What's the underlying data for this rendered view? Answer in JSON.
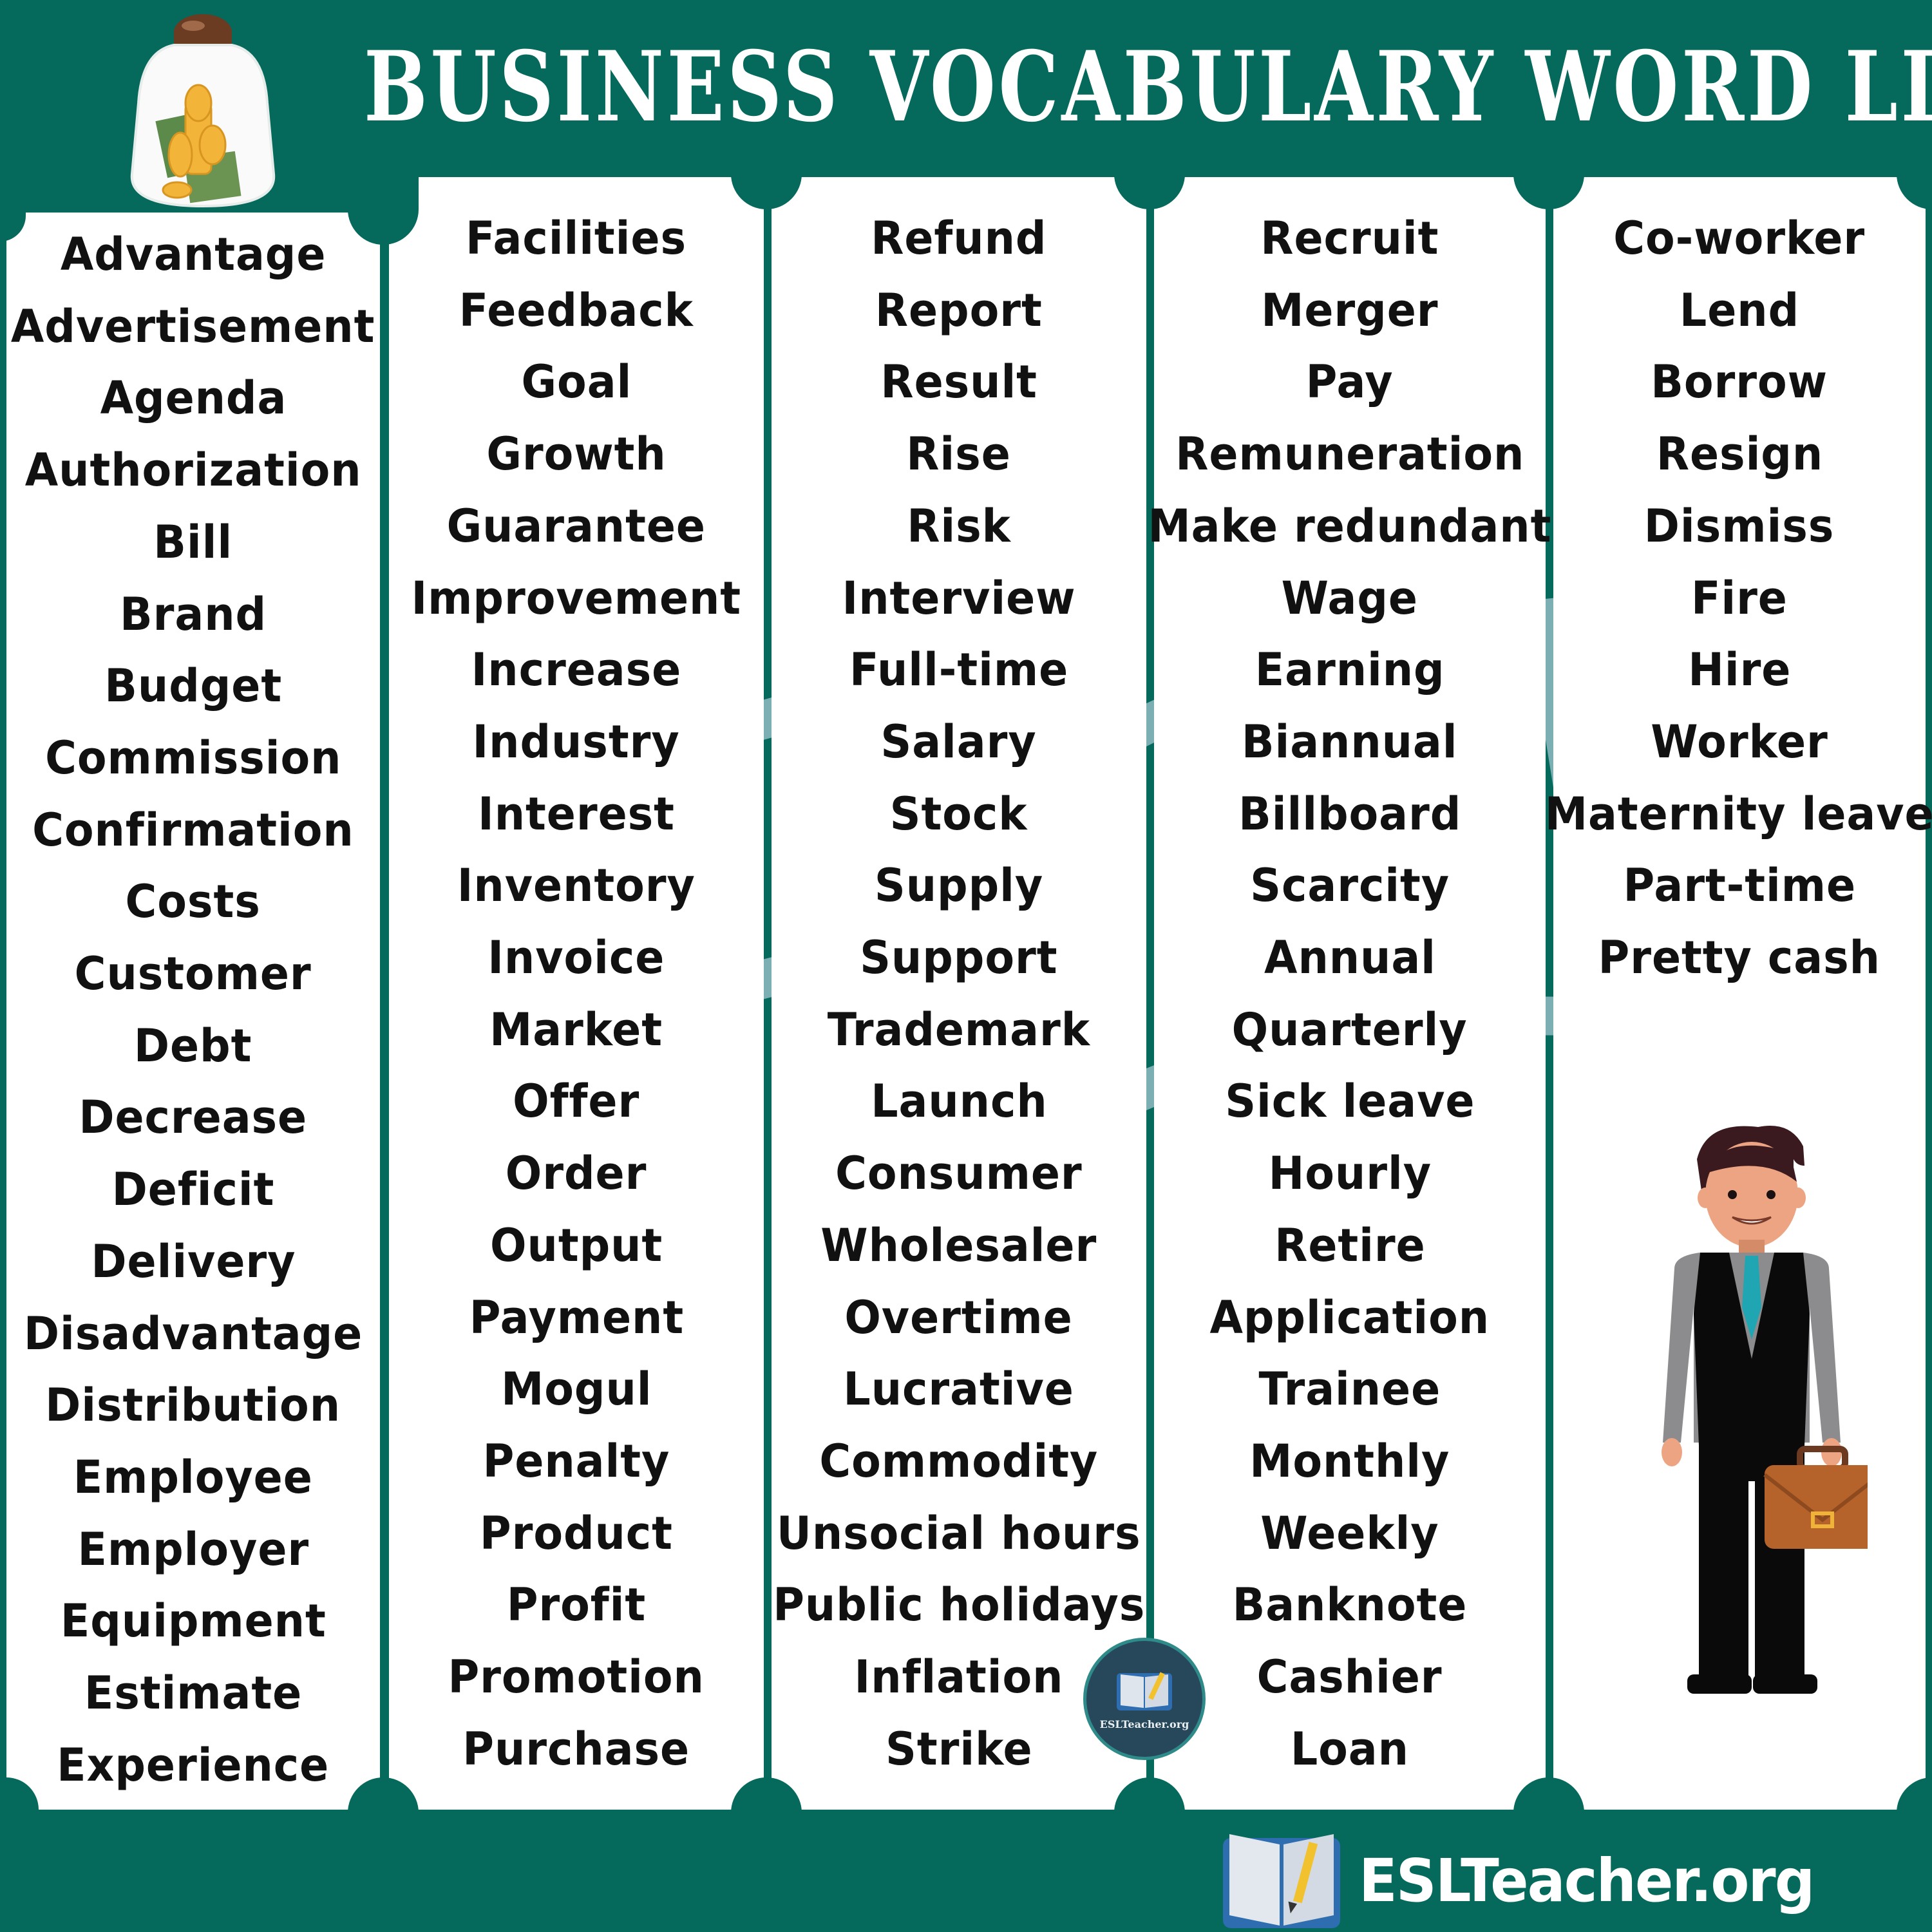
{
  "header": {
    "title": "BUSINESS VOCABULARY WORD LIST",
    "jar_icon": "coin-jar-icon"
  },
  "colors": {
    "brand_green": "#05695b",
    "panel_white": "#ffffff",
    "word_text": "#111111",
    "badge_navy": "#27485a"
  },
  "columns": [
    {
      "words": [
        "Advantage",
        "Advertisement",
        "Agenda",
        "Authorization",
        "Bill",
        "Brand",
        "Budget",
        "Commission",
        "Confirmation",
        "Costs",
        "Customer",
        "Debt",
        "Decrease",
        "Deficit",
        "Delivery",
        "Disadvantage",
        "Distribution",
        "Employee",
        "Employer",
        "Equipment",
        "Estimate",
        "Experience"
      ]
    },
    {
      "words": [
        "Facilities",
        "Feedback",
        "Goal",
        "Growth",
        "Guarantee",
        "Improvement",
        "Increase",
        "Industry",
        "Interest",
        "Inventory",
        "Invoice",
        "Market",
        "Offer",
        "Order",
        "Output",
        "Payment",
        "Mogul",
        "Penalty",
        "Product",
        "Profit",
        "Promotion",
        "Purchase"
      ]
    },
    {
      "words": [
        "Refund",
        "Report",
        "Result",
        "Rise",
        "Risk",
        "Interview",
        "Full-time",
        "Salary",
        "Stock",
        "Supply",
        "Support",
        "Trademark",
        "Launch",
        "Consumer",
        "Wholesaler",
        "Overtime",
        "Lucrative",
        "Commodity",
        "Unsocial hours",
        "Public holidays",
        "Inflation",
        "Strike"
      ]
    },
    {
      "words": [
        "Recruit",
        "Merger",
        "Pay",
        "Remuneration",
        "Make redundant",
        "Wage",
        "Earning",
        "Biannual",
        "Billboard",
        "Scarcity",
        "Annual",
        "Quarterly",
        "Sick leave",
        "Hourly",
        "Retire",
        "Application",
        "Trainee",
        "Monthly",
        "Weekly",
        "Banknote",
        "Cashier",
        "Loan"
      ]
    },
    {
      "words": [
        "Co-worker",
        "Lend",
        "Borrow",
        "Resign",
        "Dismiss",
        "Fire",
        "Hire",
        "Worker",
        "Maternity leave",
        "Part-time",
        "Pretty cash"
      ]
    }
  ],
  "badge": {
    "text": "ESLTeacher.org",
    "icon": "book-pencil-icon"
  },
  "footer": {
    "logo_text": "ESLTeacher.org",
    "icon": "book-pencil-icon"
  },
  "illustration": {
    "subject": "businessman-with-briefcase"
  }
}
